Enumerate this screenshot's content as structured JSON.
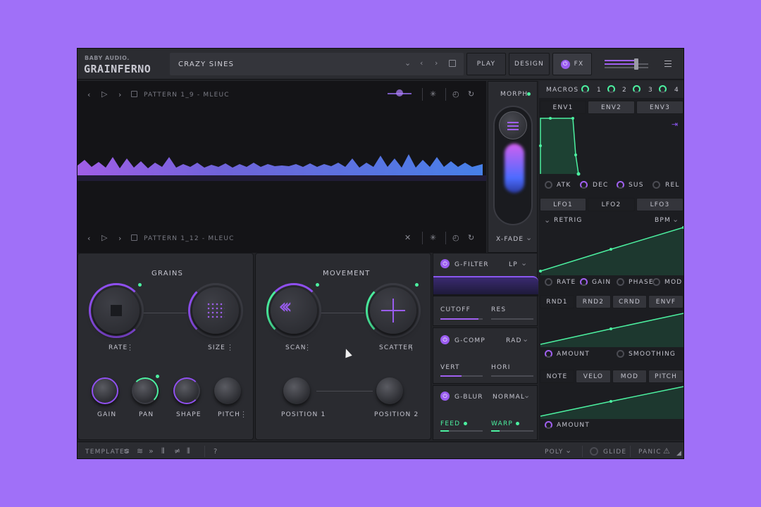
{
  "brand": {
    "company": "BABY AUDIO.",
    "product": "GRAINFERNO"
  },
  "header": {
    "preset_name": "CRAZY SINES",
    "tabs": [
      {
        "label": "PLAY"
      },
      {
        "label": "DESIGN"
      },
      {
        "label": "FX"
      }
    ],
    "active_tab": "FX",
    "output_level": 0.7
  },
  "waveform": {
    "pattern_top": "PATTERN 1_9 - MLEUC",
    "pattern_bottom": "PATTERN 1_12 - MLEUC"
  },
  "morph": {
    "label": "MORPH",
    "crossfade": "X-FADE"
  },
  "grains": {
    "title": "GRAINS",
    "knobs": [
      {
        "label": "RATE"
      },
      {
        "label": "SIZE"
      }
    ],
    "small_knobs": [
      {
        "label": "GAIN"
      },
      {
        "label": "PAN"
      },
      {
        "label": "SHAPE"
      },
      {
        "label": "PITCH"
      }
    ]
  },
  "movement": {
    "title": "MOVEMENT",
    "knobs": [
      {
        "label": "SCAN"
      },
      {
        "label": "SCATTER"
      }
    ],
    "small_knobs": [
      {
        "label": "POSITION 1"
      },
      {
        "label": "POSITION 2"
      }
    ]
  },
  "fx": {
    "filter": {
      "name": "G-FILTER",
      "mode": "LP",
      "params": [
        "CUTOFF",
        "RES"
      ],
      "levels": [
        0.9,
        0.0
      ]
    },
    "comp": {
      "name": "G-COMP",
      "mode": "RAD",
      "params": [
        "VERT",
        "HORI"
      ],
      "levels": [
        0.5,
        0.0
      ]
    },
    "blur": {
      "name": "G-BLUR",
      "mode": "NORMAL",
      "params": [
        "FEED",
        "WARP"
      ],
      "levels": [
        0.2,
        0.2
      ]
    }
  },
  "macros": {
    "label": "MACROS",
    "items": [
      "1",
      "2",
      "3",
      "4"
    ]
  },
  "envelopes": {
    "tabs": [
      "ENV1",
      "ENV2",
      "ENV3"
    ],
    "active": "ENV1",
    "params": [
      "ATK",
      "DEC",
      "SUS",
      "REL"
    ]
  },
  "lfos": {
    "tabs": [
      "LFO1",
      "LFO2",
      "LFO3"
    ],
    "active": "LFO2",
    "retrig": "RETRIG",
    "sync": "BPM",
    "params": [
      "RATE",
      "GAIN",
      "PHASE",
      "MOD"
    ]
  },
  "randoms": {
    "tabs": [
      "RND1",
      "RND2",
      "CRND",
      "ENVF"
    ],
    "active": "RND1",
    "params": [
      "AMOUNT",
      "SMOOTHING"
    ]
  },
  "note": {
    "tabs": [
      "NOTE",
      "VELO",
      "MOD",
      "PITCH"
    ],
    "active": "NOTE",
    "params": [
      "AMOUNT"
    ]
  },
  "footer": {
    "templates": "TEMPLATES",
    "help": "?",
    "voice_mode": "POLY",
    "glide": "GLIDE",
    "panic": "PANIC"
  },
  "colors": {
    "accent_purple": "#a060f0",
    "accent_green": "#4cf0a0",
    "background": "#a070f8",
    "panel": "#2a2b30"
  }
}
